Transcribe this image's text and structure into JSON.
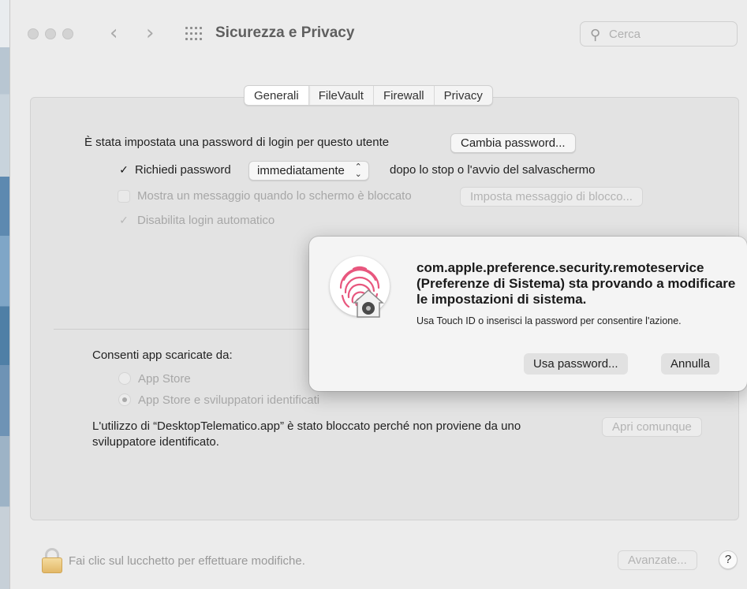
{
  "window": {
    "title": "Sicurezza e Privacy",
    "search_placeholder": "Cerca"
  },
  "tabs": [
    {
      "label": "Generali",
      "active": true
    },
    {
      "label": "FileVault",
      "active": false
    },
    {
      "label": "Firewall",
      "active": false
    },
    {
      "label": "Privacy",
      "active": false
    }
  ],
  "general": {
    "password_set_text": "È stata impostata una password di login per questo utente",
    "change_password_button": "Cambia password...",
    "require_password_label": "Richiedi password",
    "require_password_checked": true,
    "require_password_select": "immediatamente",
    "after_sleep_text": "dopo lo stop o l'avvio del salvaschermo",
    "show_message_label": "Mostra un messaggio quando lo schermo è bloccato",
    "show_message_checked": false,
    "set_lock_message_button": "Imposta messaggio di blocco...",
    "disable_autologin_label": "Disabilita login automatico",
    "disable_autologin_checked": true
  },
  "apps": {
    "allow_from_label": "Consenti app scaricate da:",
    "option_app_store": "App Store",
    "option_identified": "App Store e sviluppatori identificati",
    "selected": "App Store e sviluppatori identificati",
    "blocked_line1": "L'utilizzo di “DesktopTelematico.app” è stato bloccato perché non proviene da uno",
    "blocked_line2": "sviluppatore identificato.",
    "open_anyway_button": "Apri comunque"
  },
  "footer": {
    "lock_text": "Fai clic sul lucchetto per effettuare modifiche.",
    "advanced_button": "Avanzate...",
    "help_button": "?"
  },
  "dialog": {
    "title_line1": "com.apple.preference.security.remoteservice",
    "title_line2": "(Preferenze di Sistema) sta provando a modificare",
    "title_line3": "le impostazioni di sistema.",
    "subtitle": "Usa Touch ID o inserisci la password per consentire l'azione.",
    "use_password_button": "Usa password...",
    "cancel_button": "Annulla"
  },
  "colors": {
    "fingerprint": "#e8577e",
    "lock_gold": "#e3b867"
  }
}
